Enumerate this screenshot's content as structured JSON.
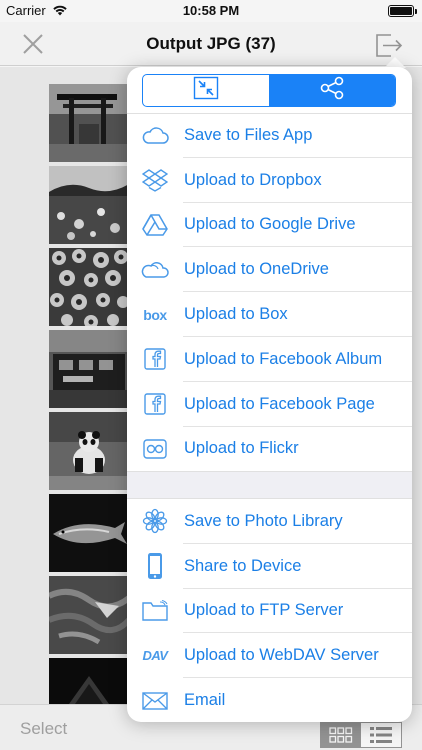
{
  "status_bar": {
    "carrier": "Carrier",
    "time": "10:58 PM",
    "battery_level": 1.0
  },
  "nav": {
    "title": "Output JPG (37)",
    "close_icon": "close-x-icon",
    "export_icon": "export-icon"
  },
  "bottom_bar": {
    "select_label": "Select",
    "grid_icon": "grid-view-icon",
    "list_icon": "list-view-icon"
  },
  "popover": {
    "segments": [
      {
        "icon": "resize-icon",
        "active": false
      },
      {
        "icon": "share-icon",
        "active": true
      }
    ],
    "upload_items": [
      {
        "label": "Save to Files App",
        "icon": "cloud-icon"
      },
      {
        "label": "Upload to Dropbox",
        "icon": "dropbox-icon"
      },
      {
        "label": "Upload to Google Drive",
        "icon": "google-drive-icon"
      },
      {
        "label": "Upload to OneDrive",
        "icon": "onedrive-icon"
      },
      {
        "label": "Upload to Box",
        "icon": "box-icon"
      },
      {
        "label": "Upload to Facebook Album",
        "icon": "facebook-icon"
      },
      {
        "label": "Upload to Facebook Page",
        "icon": "facebook-icon"
      },
      {
        "label": "Upload to Flickr",
        "icon": "flickr-icon"
      }
    ],
    "device_items": [
      {
        "label": "Save to Photo Library",
        "icon": "photos-flower-icon"
      },
      {
        "label": "Share to Device",
        "icon": "phone-icon"
      },
      {
        "label": "Upload to FTP Server",
        "icon": "folder-icon"
      },
      {
        "label": "Upload to WebDAV Server",
        "icon": "webdav-icon"
      },
      {
        "label": "Email",
        "icon": "envelope-icon"
      }
    ],
    "box_icon_text": "box",
    "webdav_icon_text": "DAV"
  },
  "colors": {
    "accent": "#1a82f7",
    "label": "#1b7fe6",
    "icon": "#4a9ae8"
  }
}
